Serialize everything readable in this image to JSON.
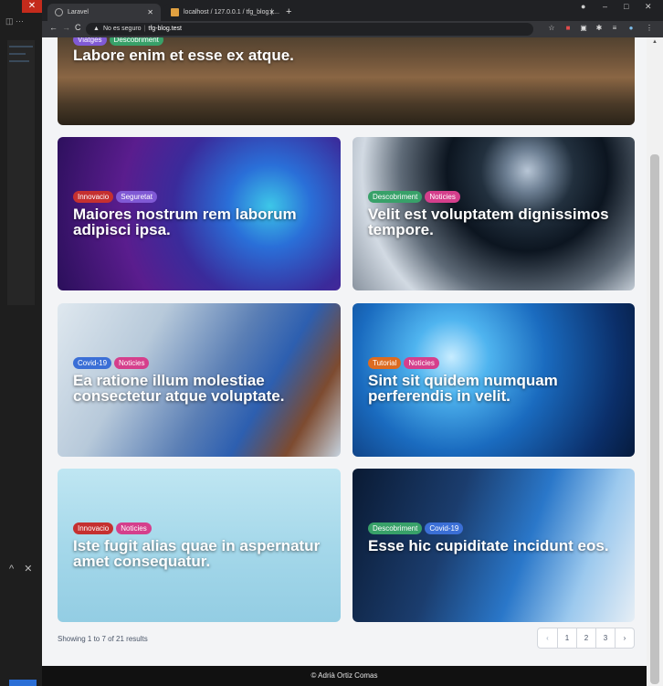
{
  "browser": {
    "tabs": [
      {
        "title": "Laravel"
      },
      {
        "title": "localhost / 127.0.0.1 / tfg_blog | ..."
      }
    ],
    "new_tab": "+",
    "security": "No es seguro",
    "url": "tfg-blog.test",
    "window_controls": [
      "–",
      "□",
      "✕"
    ]
  },
  "side_panel": {
    "close_label": "✕",
    "chevron": "^",
    "x": "✕"
  },
  "posts": [
    {
      "title": "Labore enim et esse ex atque.",
      "tags": [
        {
          "label": "Viatges",
          "color": "#805ad5"
        },
        {
          "label": "Descobriment",
          "color": "#38a169"
        }
      ]
    },
    {
      "title": "Maiores nostrum rem laborum adipisci ipsa.",
      "tags": [
        {
          "label": "Innovacio",
          "color": "#c53030"
        },
        {
          "label": "Seguretat",
          "color": "#805ad5"
        }
      ]
    },
    {
      "title": "Velit est voluptatem dignissimos tempore.",
      "tags": [
        {
          "label": "Descobriment",
          "color": "#38a169"
        },
        {
          "label": "Noticies",
          "color": "#d53f8c"
        }
      ]
    },
    {
      "title": "Ea ratione illum molestiae consectetur atque voluptate.",
      "tags": [
        {
          "label": "Covid-19",
          "color": "#3b6fd6"
        },
        {
          "label": "Noticies",
          "color": "#d53f8c"
        }
      ]
    },
    {
      "title": "Sint sit quidem numquam perferendis in velit.",
      "tags": [
        {
          "label": "Tutorial",
          "color": "#dd6b20"
        },
        {
          "label": "Noticies",
          "color": "#d53f8c"
        }
      ]
    },
    {
      "title": "Iste fugit alias quae in aspernatur amet consequatur.",
      "tags": [
        {
          "label": "Innovacio",
          "color": "#c53030"
        },
        {
          "label": "Noticies",
          "color": "#d53f8c"
        }
      ]
    },
    {
      "title": "Esse hic cupiditate incidunt eos.",
      "tags": [
        {
          "label": "Descobriment",
          "color": "#38a169"
        },
        {
          "label": "Covid-19",
          "color": "#3b6fd6"
        }
      ]
    }
  ],
  "pagination": {
    "summary": "Showing 1 to 7 of 21 results",
    "prev": "‹",
    "pages": [
      "1",
      "2",
      "3"
    ],
    "next": "›"
  },
  "footer": {
    "text": "© Adrià Ortiz Comas"
  }
}
